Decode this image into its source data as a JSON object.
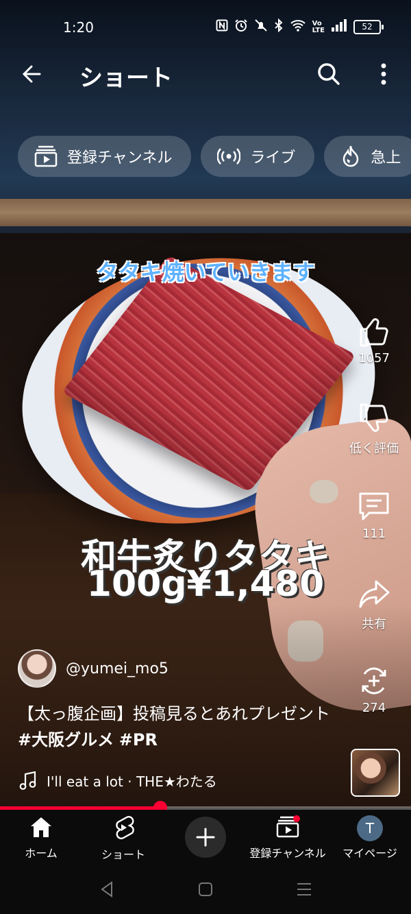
{
  "status_bar": {
    "time": "1:20",
    "battery": "52"
  },
  "top_bar": {
    "title": "ショート"
  },
  "chips": [
    {
      "label": "登録チャンネル",
      "icon": "subscriptions-icon"
    },
    {
      "label": "ライブ",
      "icon": "live-icon"
    },
    {
      "label": "急上",
      "icon": "trending-icon"
    }
  ],
  "video": {
    "caption_top": "タタキ焼いていきます",
    "caption_line1": "和牛炙りタタキ",
    "caption_line2": "100g¥1,480"
  },
  "actions": {
    "like_count": "1057",
    "dislike_label": "低く評価",
    "comment_count": "111",
    "share_label": "共有",
    "remix_count": "274"
  },
  "channel": {
    "handle": "@yumei_mo5"
  },
  "description": {
    "text_prefix": "【太っ腹企画】投稿見るとあれプレゼント ",
    "tag1": "#大阪グルメ",
    "tag2": "#PR"
  },
  "music": {
    "text": "I'll eat a lot · THE★わたる"
  },
  "progress": {
    "fraction": 0.39
  },
  "bottom_nav": {
    "home": "ホーム",
    "shorts": "ショート",
    "subscriptions": "登録チャンネル",
    "mypage": "マイページ",
    "avatar_letter": "T"
  },
  "colors": {
    "accent": "#ff0033",
    "caption_blue": "#5eb2ff"
  }
}
